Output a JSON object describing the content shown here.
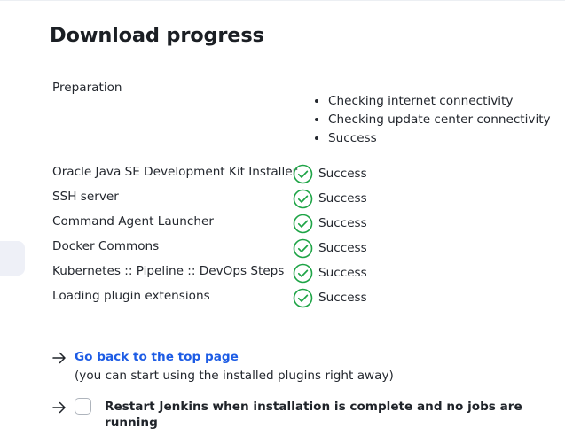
{
  "page": {
    "title": "Download progress"
  },
  "preparation": {
    "label": "Preparation",
    "checks": [
      "Checking internet connectivity",
      "Checking update center connectivity",
      "Success"
    ]
  },
  "plugins": [
    {
      "name": "Oracle Java SE Development Kit Installer",
      "status": "Success"
    },
    {
      "name": "SSH server",
      "status": "Success"
    },
    {
      "name": "Command Agent Launcher",
      "status": "Success"
    },
    {
      "name": "Docker Commons",
      "status": "Success"
    },
    {
      "name": "Kubernetes :: Pipeline :: DevOps Steps",
      "status": "Success"
    },
    {
      "name": "Loading plugin extensions",
      "status": "Success"
    }
  ],
  "actions": {
    "top_page_link": "Go back to the top page",
    "top_page_note": "(you can start using the installed plugins right away)",
    "restart_label": "Restart Jenkins when installation is complete and no jobs are running"
  },
  "icons": {
    "status": "success-check-circle-icon",
    "bullet": "arrow-right-icon"
  },
  "colors": {
    "success": "#1ea446",
    "link": "#1d5ce5"
  }
}
